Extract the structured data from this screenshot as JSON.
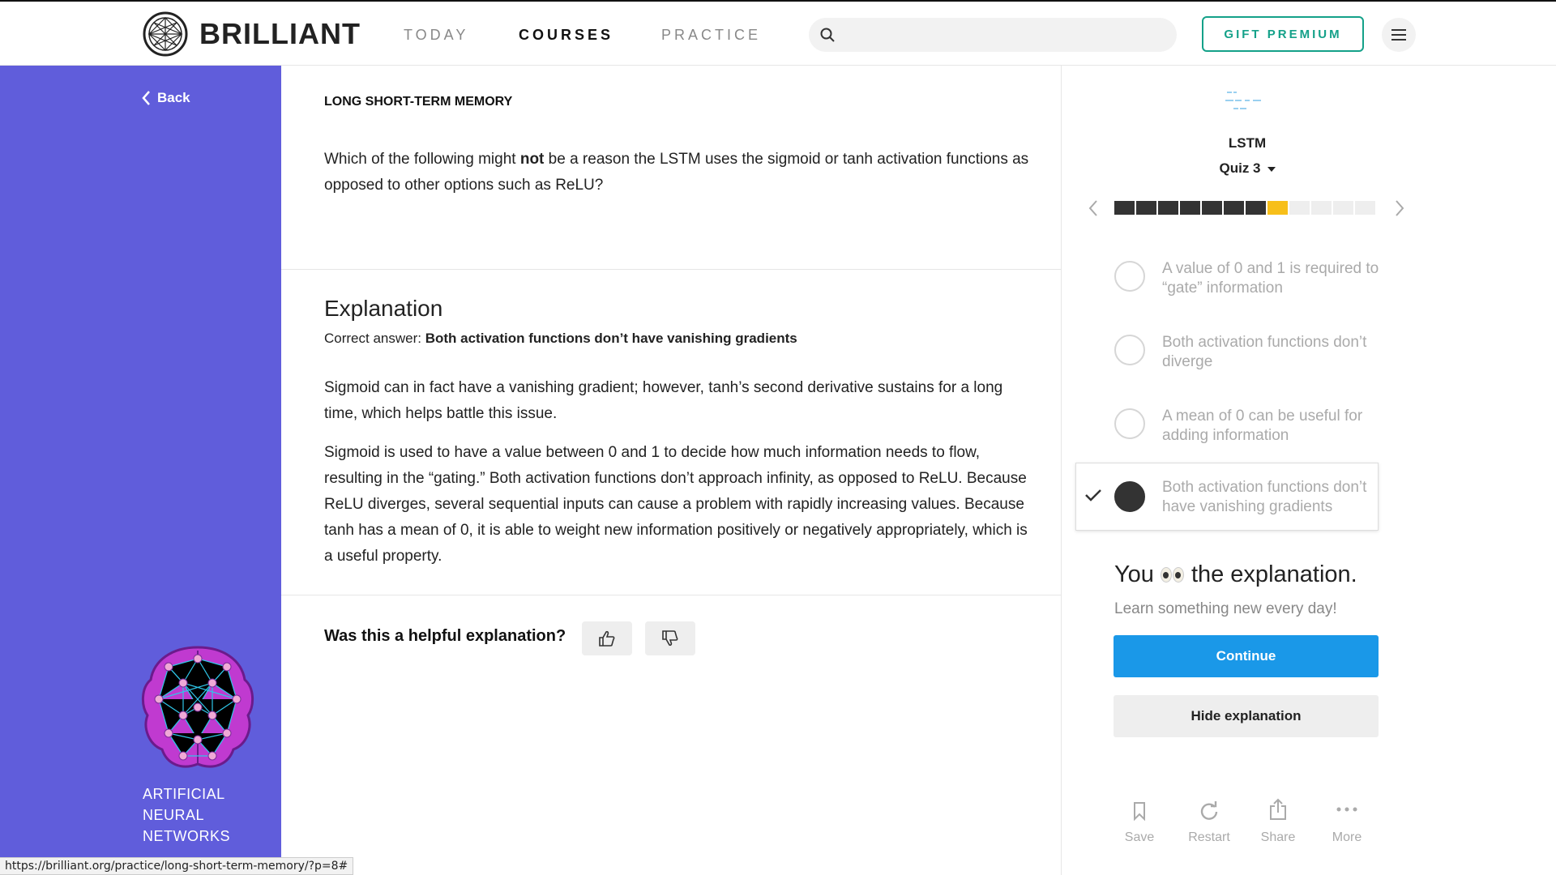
{
  "header": {
    "brand": "BRILLIANT",
    "nav": [
      {
        "label": "TODAY",
        "active": false
      },
      {
        "label": "COURSES",
        "active": true
      },
      {
        "label": "PRACTICE",
        "active": false
      }
    ],
    "search_placeholder": "",
    "gift_label": "GIFT PREMIUM"
  },
  "sidebar": {
    "back_label": "Back",
    "course_title": "ARTIFICIAL NEURAL NETWORKS",
    "accent_color": "#605ddb"
  },
  "main": {
    "breadcrumb": "LONG SHORT-TERM MEMORY",
    "question": {
      "before": "Which of the following might ",
      "emphasis": "not",
      "after": " be a reason the LSTM uses the sigmoid or tanh activation functions as opposed to other options such as ReLU?"
    },
    "explanation": {
      "title": "Explanation",
      "correct_prefix": "Correct answer: ",
      "correct_answer": "Both activation functions don’t have vanishing gradients",
      "paragraphs": [
        "Sigmoid can in fact have a vanishing gradient; however, tanh’s second derivative sustains for a long time, which helps battle this issue.",
        "Sigmoid is used to have a value between 0 and 1 to decide how much information needs to flow, resulting in the “gating.” Both activation functions don’t approach infinity, as opposed to ReLU. Because ReLU diverges, several sequential inputs can cause a problem with rapidly increasing values. Because tanh has a mean of 0, it is able to weight new information positively or negatively appropriately, which is a useful property."
      ]
    },
    "feedback_question": "Was this a helpful explanation?"
  },
  "quiz": {
    "name": "LSTM",
    "number": "Quiz 3",
    "progress": {
      "total": 12,
      "completed": 7,
      "current": 8
    },
    "options": [
      {
        "label": "A value of 0 and 1 is required to “gate” information",
        "selected": false
      },
      {
        "label": "Both activation functions don’t diverge",
        "selected": false
      },
      {
        "label": "A mean of 0 can be useful for adding information",
        "selected": false
      },
      {
        "label": "Both activation functions don’t have vanishing gradients",
        "selected": true
      }
    ],
    "result_before": "You",
    "result_after": "the explanation.",
    "subtitle": "Learn something new every day!",
    "continue_label": "Continue",
    "hide_label": "Hide explanation",
    "actions": [
      "Save",
      "Restart",
      "Share",
      "More"
    ],
    "progress_done_color": "#333333",
    "progress_current_color": "#f7bf1a",
    "continue_color": "#1a98e8"
  },
  "status_url": "https://brilliant.org/practice/long-short-term-memory/?p=8#"
}
